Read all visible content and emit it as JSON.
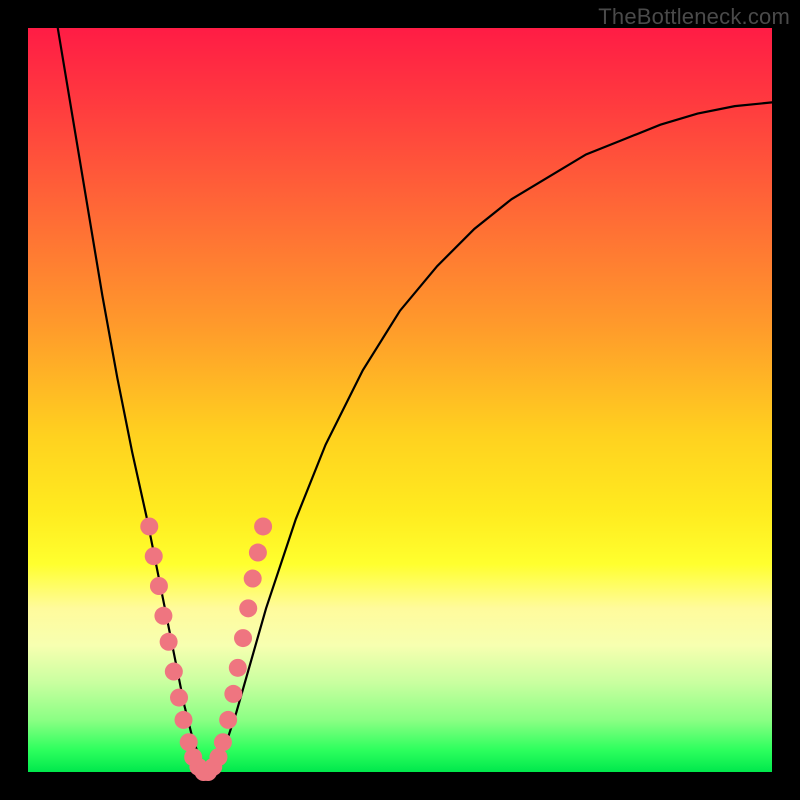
{
  "watermark": "TheBottleneck.com",
  "colors": {
    "frame": "#000000",
    "marker": "#ef7580",
    "curve": "#000000"
  },
  "chart_data": {
    "type": "line",
    "title": "",
    "xlabel": "",
    "ylabel": "",
    "xlim": [
      0,
      100
    ],
    "ylim": [
      0,
      100
    ],
    "series": [
      {
        "name": "bottleneck-curve",
        "x": [
          4,
          6,
          8,
          10,
          12,
          14,
          16,
          18,
          19,
          20,
          21,
          22,
          23,
          24,
          25,
          26,
          28,
          30,
          32,
          36,
          40,
          45,
          50,
          55,
          60,
          65,
          70,
          75,
          80,
          85,
          90,
          95,
          100
        ],
        "y": [
          100,
          88,
          76,
          64,
          53,
          43,
          34,
          24,
          19,
          14,
          9,
          5,
          2,
          0,
          0,
          2,
          8,
          15,
          22,
          34,
          44,
          54,
          62,
          68,
          73,
          77,
          80,
          83,
          85,
          87,
          88.5,
          89.5,
          90
        ]
      }
    ],
    "markers": {
      "name": "highlight-points",
      "x": [
        16.3,
        16.9,
        17.6,
        18.2,
        18.9,
        19.6,
        20.3,
        20.9,
        21.6,
        22.2,
        22.9,
        23.6,
        24.2,
        24.9,
        25.6,
        26.2,
        26.9,
        27.6,
        28.2,
        28.9,
        29.6,
        30.2,
        30.9,
        31.6
      ],
      "y": [
        33,
        29,
        25,
        21,
        17.5,
        13.5,
        10,
        7,
        4,
        2,
        0.7,
        0,
        0,
        0.7,
        2,
        4,
        7,
        10.5,
        14,
        18,
        22,
        26,
        29.5,
        33
      ]
    },
    "gradient_stops": [
      {
        "pos": 0,
        "color": "#ff1c45"
      },
      {
        "pos": 55,
        "color": "#ffd21f"
      },
      {
        "pos": 100,
        "color": "#00e84c"
      }
    ]
  }
}
